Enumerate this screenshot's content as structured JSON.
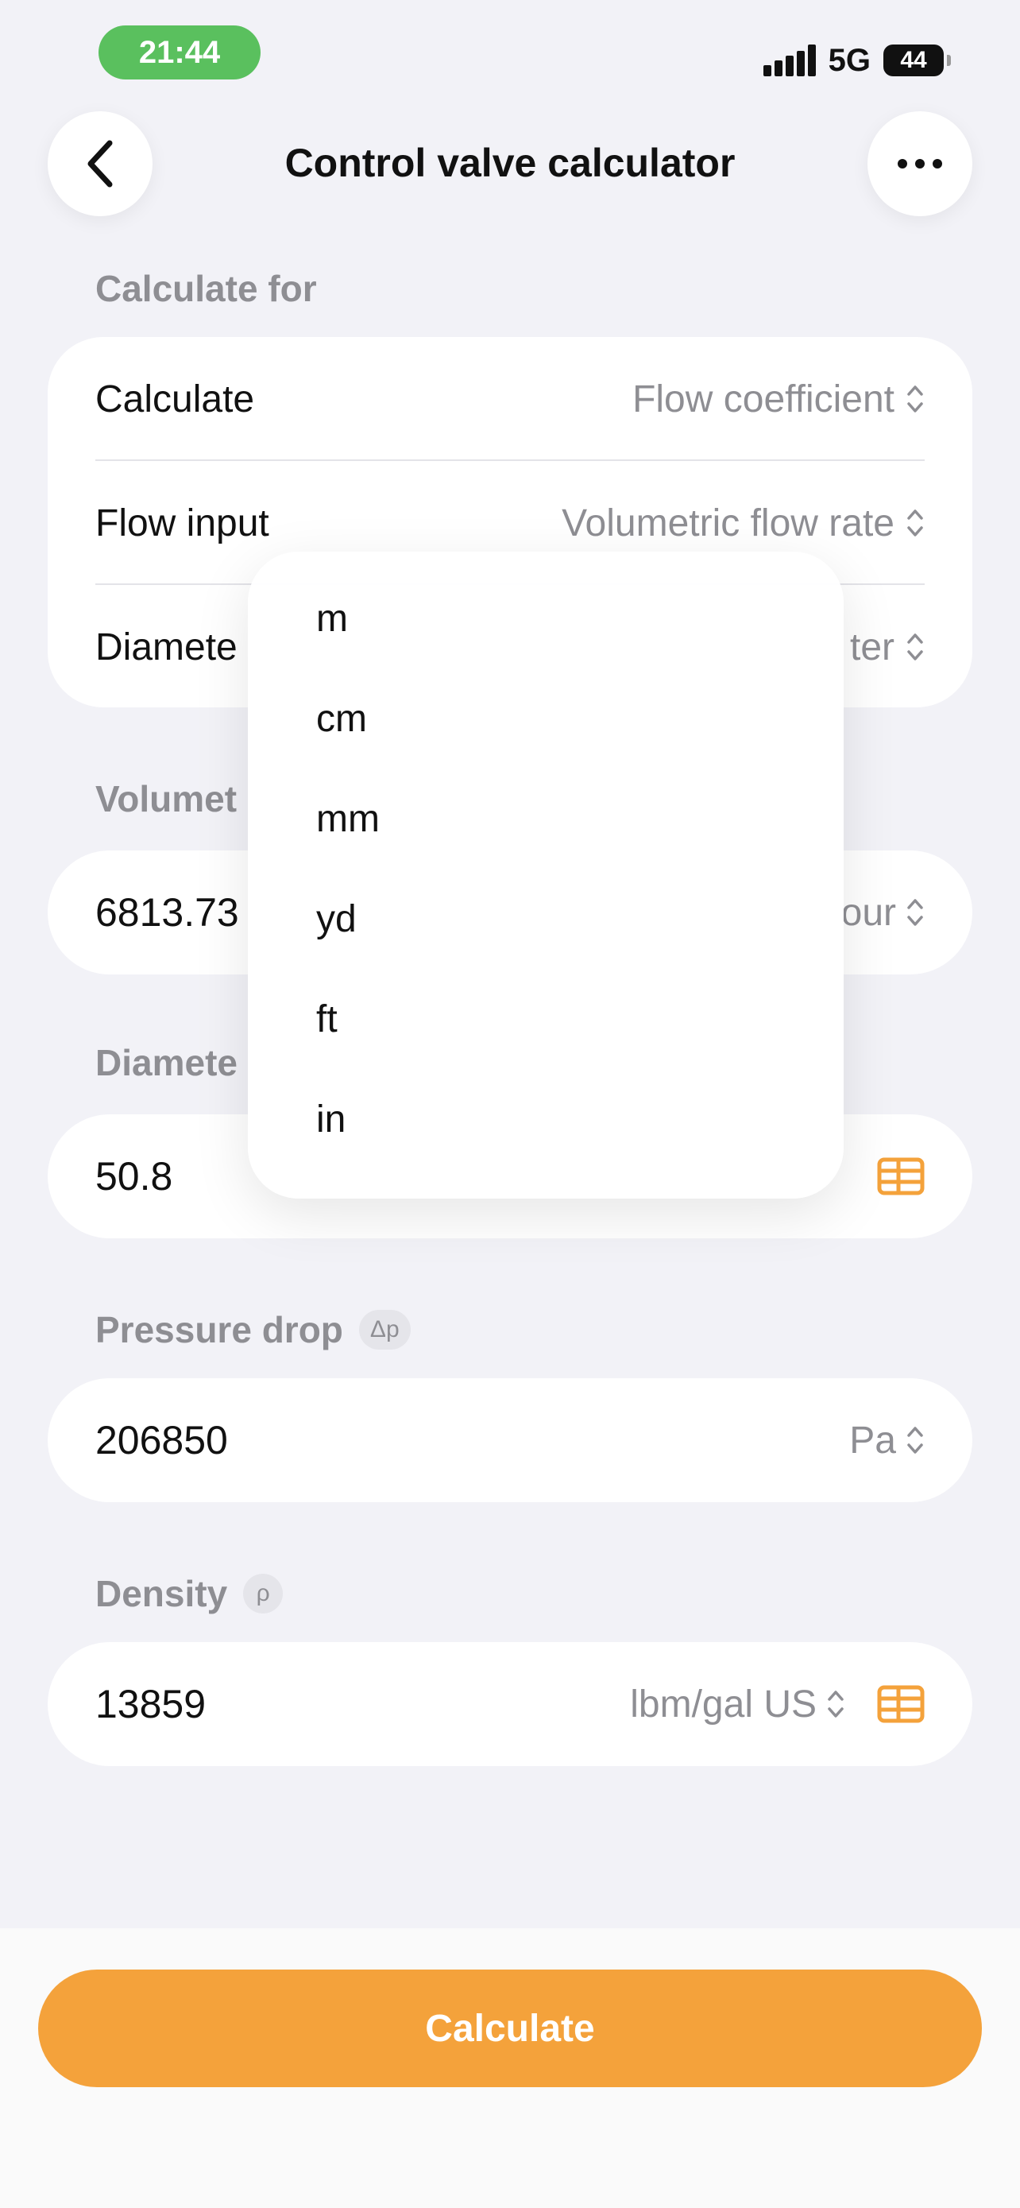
{
  "status": {
    "time": "21:44",
    "network": "5G",
    "battery": "44"
  },
  "nav": {
    "title": "Control valve calculator"
  },
  "calculate_for": {
    "label": "Calculate for",
    "rows": [
      {
        "label": "Calculate",
        "value": "Flow coefficient"
      },
      {
        "label": "Flow input",
        "value": "Volumetric flow rate"
      },
      {
        "label": "Diamete",
        "value": "ter"
      }
    ]
  },
  "volumetric": {
    "label": "Volumet",
    "value": "6813.73",
    "unit": "our"
  },
  "diameter": {
    "label": "Diamete",
    "value": "50.8"
  },
  "pressure": {
    "label": "Pressure drop",
    "symbol": "Δp",
    "value": "206850",
    "unit": "Pa"
  },
  "density": {
    "label": "Density",
    "symbol": "ρ",
    "value": "13859",
    "unit": "lbm/gal US"
  },
  "dropdown": {
    "options": [
      "m",
      "cm",
      "mm",
      "yd",
      "ft",
      "in"
    ]
  },
  "footer": {
    "calculate_label": "Calculate"
  },
  "colors": {
    "accent": "#f4a23b",
    "status_green": "#5ac05e",
    "muted": "#8e8e93",
    "background": "#f2f2f7"
  }
}
